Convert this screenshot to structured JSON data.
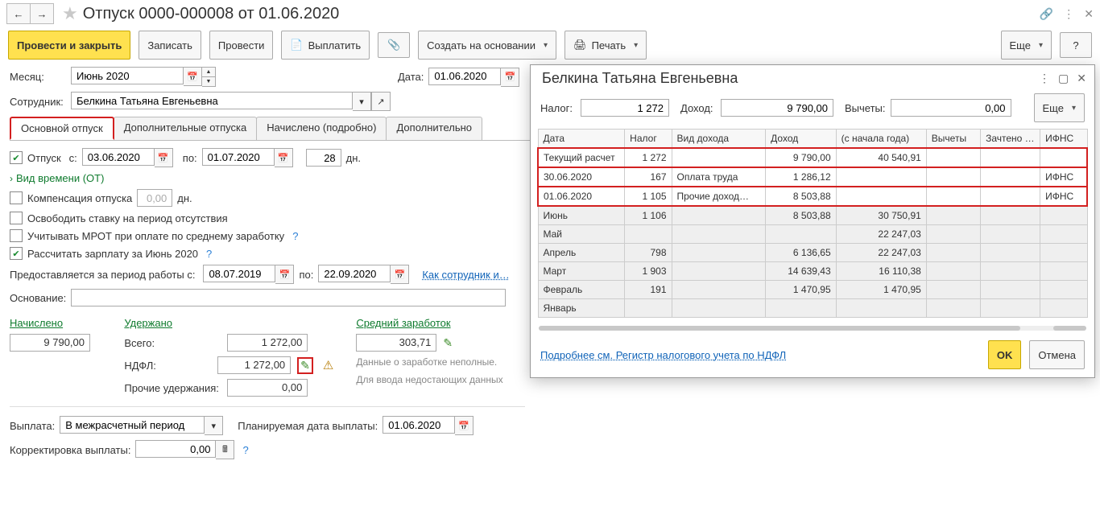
{
  "title": "Отпуск 0000-000008 от 01.06.2020",
  "nav": {
    "back": "←",
    "fwd": "→"
  },
  "toolbar": {
    "post_close": "Провести и закрыть",
    "write": "Записать",
    "post": "Провести",
    "pay": "Выплатить",
    "create_based": "Создать на основании",
    "print": "Печать",
    "more": "Еще",
    "help": "?"
  },
  "form": {
    "month_label": "Месяц:",
    "month_value": "Июнь 2020",
    "date_label": "Дата:",
    "date_value": "01.06.2020",
    "employee_label": "Сотрудник:",
    "employee_value": "Белкина Татьяна Евгеньевна"
  },
  "tabs": {
    "main": "Основной отпуск",
    "extra": "Дополнительные отпуска",
    "accrued": "Начислено (подробно)",
    "additional": "Дополнительно"
  },
  "vacation": {
    "label": "Отпуск",
    "from_label": "с:",
    "from": "03.06.2020",
    "to_label": "по:",
    "to": "01.07.2020",
    "days": "28",
    "days_suffix": "дн.",
    "time_type": "Вид времени (ОТ)",
    "compensation_label": "Компенсация отпуска",
    "compensation_val": "0,00",
    "release_rate": "Освободить ставку на период отсутствия",
    "use_mrot": "Учитывать МРОТ при оплате по среднему заработку",
    "calc_salary": "Рассчитать зарплату за Июнь 2020",
    "period_label": "Предоставляется за период работы с:",
    "period_from": "08.07.2019",
    "period_to_label": "по:",
    "period_to": "22.09.2020",
    "how_link": "Как сотрудник и…",
    "basis_label": "Основание:"
  },
  "summary": {
    "accrued_head": "Начислено",
    "accrued_val": "9 790,00",
    "withheld_head": "Удержано",
    "withheld_total_label": "Всего:",
    "withheld_total": "1 272,00",
    "ndfl_label": "НДФЛ:",
    "ndfl_val": "1 272,00",
    "other_label": "Прочие удержания:",
    "other_val": "0,00",
    "avg_head": "Средний заработок",
    "avg_val": "303,71",
    "warn1": "Данные о заработке неполные.",
    "warn2": "Для ввода недостающих данных"
  },
  "bottom": {
    "payment_label": "Выплата:",
    "payment_value": "В межрасчетный период",
    "planned_label": "Планируемая дата выплаты:",
    "planned_value": "01.06.2020",
    "corr_label": "Корректировка выплаты:",
    "corr_value": "0,00"
  },
  "popup": {
    "title": "Белкина Татьяна Евгеньевна",
    "tax_label": "Налог:",
    "tax_val": "1 272",
    "income_label": "Доход:",
    "income_val": "9 790,00",
    "deduct_label": "Вычеты:",
    "deduct_val": "0,00",
    "more": "Еще",
    "headers": [
      "Дата",
      "Налог",
      "Вид дохода",
      "Доход",
      "(с начала года)",
      "Вычеты",
      "Зачтено …",
      "ИФНС"
    ],
    "rows_highlight": [
      {
        "date": "Текущий расчет",
        "tax": "1 272",
        "type": "",
        "income": "9 790,00",
        "ytd": "40 540,91",
        "ded": "",
        "off": "",
        "ifns": ""
      },
      {
        "date": "30.06.2020",
        "tax": "167",
        "type": "Оплата труда",
        "income": "1 286,12",
        "ytd": "",
        "ded": "",
        "off": "",
        "ifns": "ИФНС"
      },
      {
        "date": "01.06.2020",
        "tax": "1 105",
        "type": "Прочие доход…",
        "income": "8 503,88",
        "ytd": "",
        "ded": "",
        "off": "",
        "ifns": "ИФНС"
      }
    ],
    "rows_months": [
      {
        "date": "Июнь",
        "tax": "1 106",
        "type": "",
        "income": "8 503,88",
        "ytd": "30 750,91",
        "ded": "",
        "off": "",
        "ifns": ""
      },
      {
        "date": "Май",
        "tax": "",
        "type": "",
        "income": "",
        "ytd": "22 247,03",
        "ded": "",
        "off": "",
        "ifns": ""
      },
      {
        "date": "Апрель",
        "tax": "798",
        "type": "",
        "income": "6 136,65",
        "ytd": "22 247,03",
        "ded": "",
        "off": "",
        "ifns": ""
      },
      {
        "date": "Март",
        "tax": "1 903",
        "type": "",
        "income": "14 639,43",
        "ytd": "16 110,38",
        "ded": "",
        "off": "",
        "ifns": ""
      },
      {
        "date": "Февраль",
        "tax": "191",
        "type": "",
        "income": "1 470,95",
        "ytd": "1 470,95",
        "ded": "",
        "off": "",
        "ifns": ""
      },
      {
        "date": "Январь",
        "tax": "",
        "type": "",
        "income": "",
        "ytd": "",
        "ded": "",
        "off": "",
        "ifns": ""
      }
    ],
    "footer_link": "Подробнее см. Регистр налогового учета по НДФЛ",
    "ok": "OK",
    "cancel": "Отмена"
  }
}
